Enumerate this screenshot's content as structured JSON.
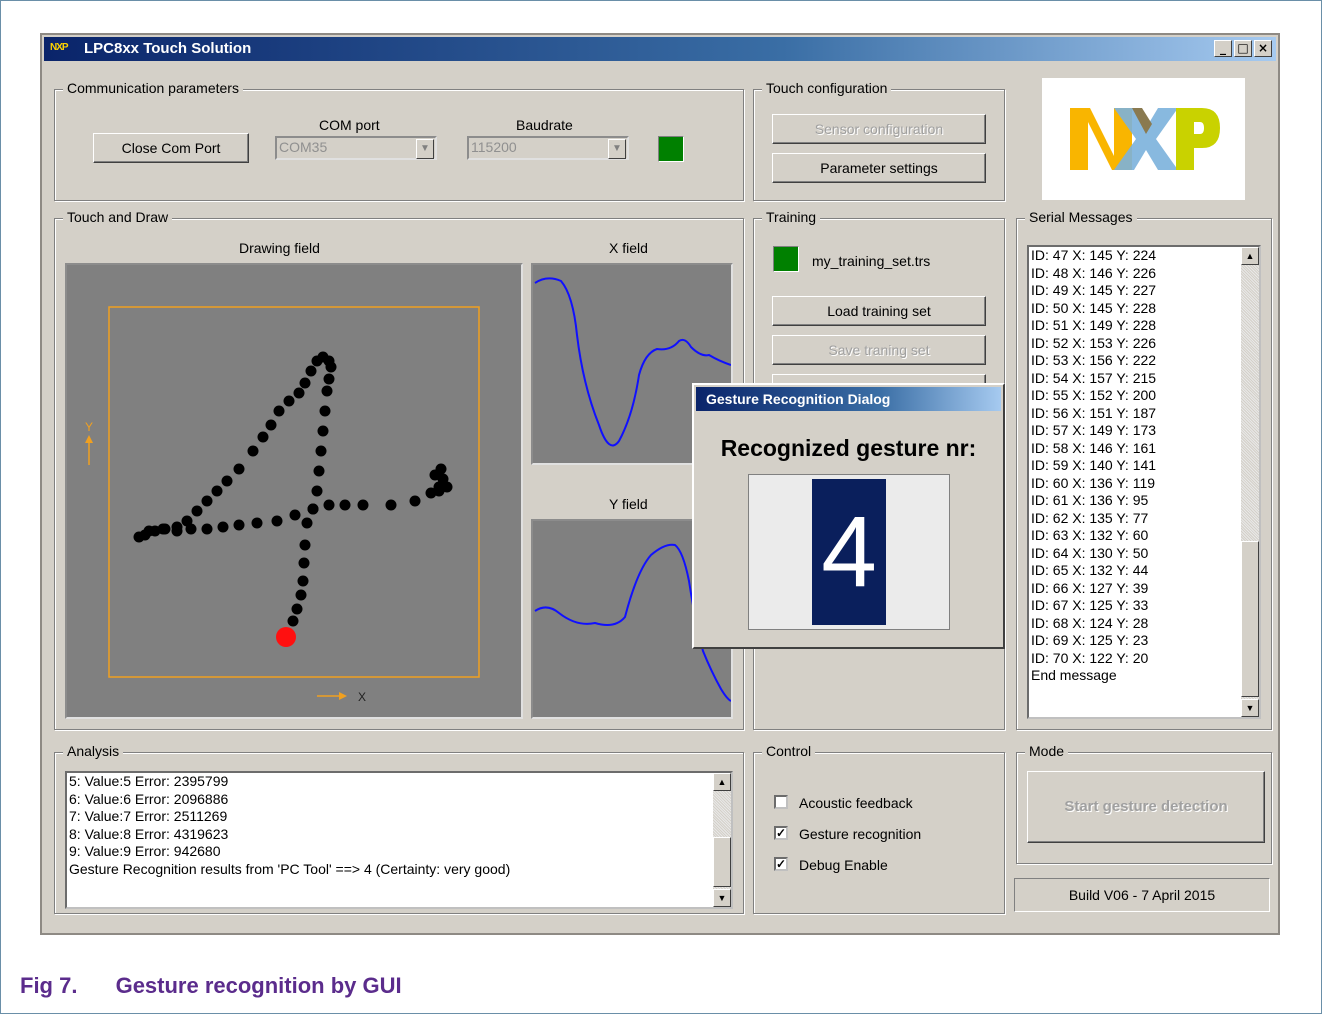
{
  "window": {
    "title": "LPC8xx Touch Solution",
    "logo_text": "NXP"
  },
  "window_buttons": {
    "minimize": "_",
    "maximize": "□",
    "close": "×"
  },
  "communication": {
    "label": "Communication parameters",
    "close_button": "Close Com Port",
    "com_port_label": "COM port",
    "com_port_value": "COM35",
    "baudrate_label": "Baudrate",
    "baudrate_value": "115200",
    "status_color": "#008000"
  },
  "touch_config": {
    "label": "Touch configuration",
    "sensor_button": "Sensor configuration",
    "parameter_button": "Parameter settings"
  },
  "logo": {
    "text": "NXP",
    "colors": [
      "#f9b500",
      "#7bb1db",
      "#c9d200"
    ]
  },
  "touch_draw": {
    "label": "Touch and Draw",
    "drawing_field_label": "Drawing field",
    "x_field_label": "X field",
    "y_field_label": "Y field",
    "axis_y": "Y",
    "axis_x": "X"
  },
  "training": {
    "label": "Training",
    "file_name": "my_training_set.trs",
    "load_button": "Load training set",
    "save_button": "Save traning set"
  },
  "serial": {
    "label": "Serial Messages",
    "lines": [
      "ID: 47 X: 145 Y: 224",
      "ID: 48 X: 146 Y: 226",
      "ID: 49 X: 145 Y: 227",
      "ID: 50 X: 145 Y: 228",
      "ID: 51 X: 149 Y: 228",
      "ID: 52 X: 153 Y: 226",
      "ID: 53 X: 156 Y: 222",
      "ID: 54 X: 157 Y: 215",
      "ID: 55 X: 152 Y: 200",
      "ID: 56 X: 151 Y: 187",
      "ID: 57 X: 149 Y: 173",
      "ID: 58 X: 146 Y: 161",
      "ID: 59 X: 140 Y: 141",
      "ID: 60 X: 136 Y: 119",
      "ID: 61 X: 136 Y: 95",
      "ID: 62 X: 135 Y: 77",
      "ID: 63 X: 132 Y: 60",
      "ID: 64 X: 130 Y: 50",
      "ID: 65 X: 132 Y: 44",
      "ID: 66 X: 127 Y: 39",
      "ID: 67 X: 125 Y: 33",
      "ID: 68 X: 124 Y: 28",
      "ID: 69 X: 125 Y: 23",
      "ID: 70 X: 122 Y: 20",
      "End message"
    ]
  },
  "analysis": {
    "label": "Analysis",
    "lines": [
      "5: Value:5 Error: 2395799",
      "6: Value:6 Error: 2096886",
      "7: Value:7 Error: 2511269",
      "8: Value:8 Error: 4319623",
      "9: Value:9 Error: 942680",
      "Gesture Recognition results from 'PC Tool' ==> 4 (Certainty: very good)"
    ]
  },
  "control": {
    "label": "Control",
    "acoustic": "Acoustic feedback",
    "acoustic_checked": false,
    "gesture": "Gesture recognition",
    "gesture_checked": true,
    "debug": "Debug Enable",
    "debug_checked": true,
    "check_mark": "✓"
  },
  "mode": {
    "label": "Mode",
    "start_button": "Start gesture detection"
  },
  "build": "Build V06  -  7 April 2015",
  "dialog": {
    "title": "Gesture Recognition Dialog",
    "heading": "Recognized gesture nr:",
    "value": "4"
  },
  "figure": {
    "number": "Fig 7.",
    "caption": "Gesture recognition by GUI"
  }
}
